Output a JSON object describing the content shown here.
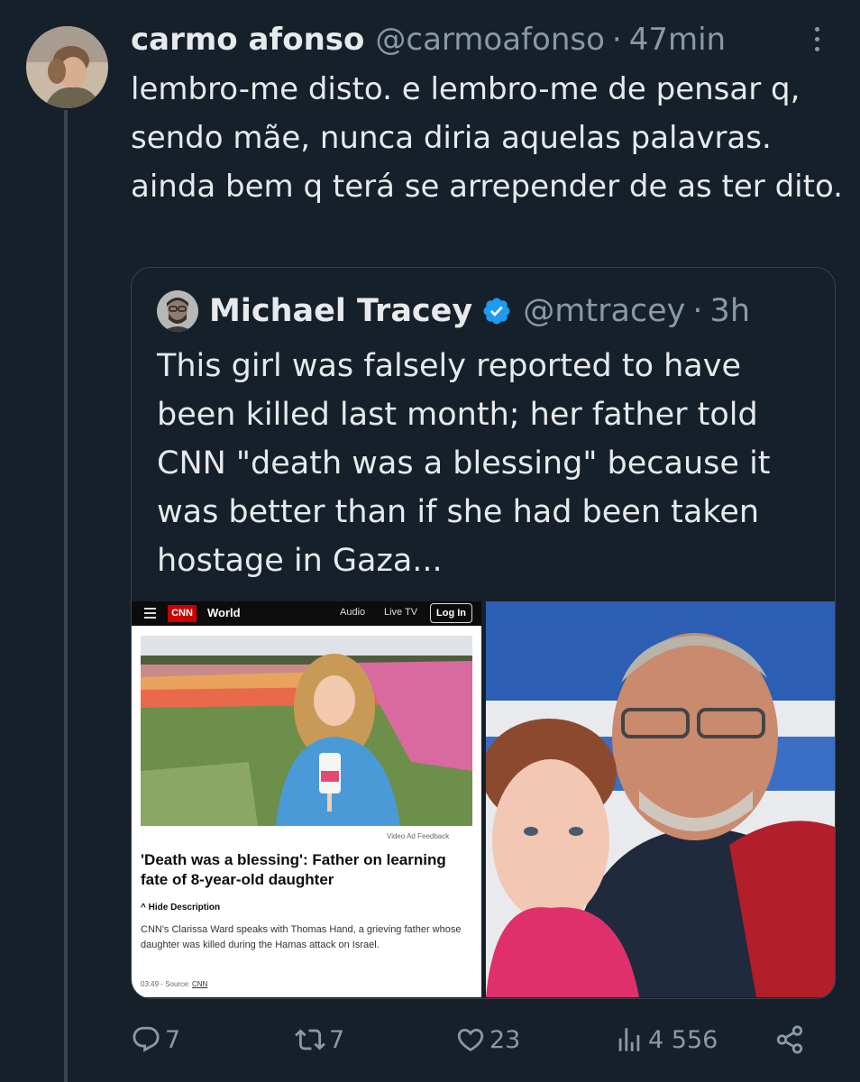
{
  "tweet": {
    "author_name": "carmo afonso",
    "handle": "@carmoafonso",
    "separator": "·",
    "time": "47min",
    "text": "lembro-me disto. e lembro-me de pensar q, sendo mãe, nunca diria aquelas palavras. ainda bem q terá se arrepender de as ter dito."
  },
  "quote": {
    "author_name": "Michael Tracey",
    "handle": "@mtracey",
    "separator": "·",
    "time": "3h",
    "text": "This girl was falsely reported to have been killed last month; her father told CNN \"death was a blessing\" because it was better than if she had been taken hostage in Gaza..."
  },
  "cnn": {
    "logo": "CNN",
    "section": "World",
    "nav_audio": "Audio",
    "nav_live": "Live TV",
    "nav_login": "Log In",
    "video_feedback": "Video Ad Feedback",
    "headline": "'Death was a blessing': Father on learning fate of 8-year-old daughter",
    "hide_description": "Hide Description",
    "description": "CNN's Clarissa Ward speaks with Thomas Hand, a grieving father whose daughter was killed during the Hamas attack on Israel.",
    "duration": "03:49",
    "source_label": "- Source:",
    "source": "CNN"
  },
  "actions": {
    "replies": "7",
    "reposts": "7",
    "likes": "23",
    "views": "4 556"
  },
  "icons": {
    "more": "more-icon",
    "verified": "verified-badge-icon",
    "reply": "reply-icon",
    "repost": "repost-icon",
    "like": "heart-icon",
    "views": "views-icon",
    "share": "share-icon"
  },
  "colors": {
    "background": "#15202b",
    "text": "#e7e9ea",
    "muted": "#8b98a5",
    "border": "#38444d",
    "verified": "#1d9bf0",
    "cnn_red": "#cc0000"
  }
}
